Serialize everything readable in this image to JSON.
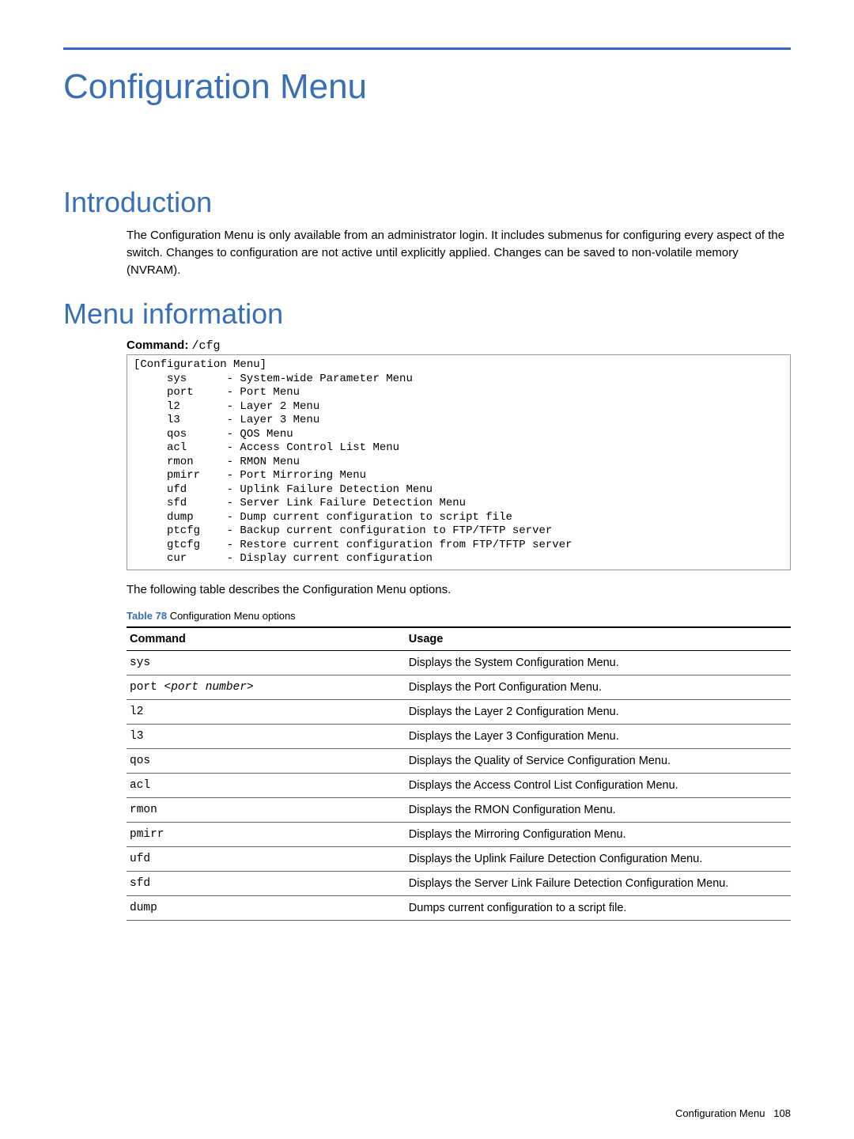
{
  "chapter_title": "Configuration Menu",
  "intro": {
    "heading": "Introduction",
    "body": "The Configuration Menu is only available from an administrator login. It includes submenus for configuring every aspect of the switch. Changes to configuration are not active until explicitly applied. Changes can be saved to non-volatile memory (NVRAM)."
  },
  "menu_info": {
    "heading": "Menu information",
    "command_label": "Command:",
    "command_value": "/cfg",
    "code": "[Configuration Menu]\n     sys      - System-wide Parameter Menu\n     port     - Port Menu\n     l2       - Layer 2 Menu\n     l3       - Layer 3 Menu\n     qos      - QOS Menu\n     acl      - Access Control List Menu\n     rmon     - RMON Menu\n     pmirr    - Port Mirroring Menu\n     ufd      - Uplink Failure Detection Menu\n     sfd      - Server Link Failure Detection Menu\n     dump     - Dump current configuration to script file\n     ptcfg    - Backup current configuration to FTP/TFTP server\n     gtcfg    - Restore current configuration from FTP/TFTP server\n     cur      - Display current configuration",
    "after_code_text": "The following table describes the Configuration Menu options.",
    "table_label": "Table 78",
    "table_caption": "Configuration Menu options",
    "table_head_command": "Command",
    "table_head_usage": "Usage",
    "rows": [
      {
        "cmd": "sys",
        "usage": "Displays the System Configuration Menu."
      },
      {
        "cmd": "port <port number>",
        "usage": "Displays the Port Configuration Menu."
      },
      {
        "cmd": "l2",
        "usage": "Displays the Layer 2 Configuration Menu."
      },
      {
        "cmd": "l3",
        "usage": "Displays the Layer 3 Configuration Menu."
      },
      {
        "cmd": "qos",
        "usage": "Displays the Quality of Service Configuration Menu."
      },
      {
        "cmd": "acl",
        "usage": "Displays the Access Control List Configuration Menu."
      },
      {
        "cmd": "rmon",
        "usage": "Displays the RMON Configuration Menu."
      },
      {
        "cmd": "pmirr",
        "usage": "Displays the Mirroring Configuration Menu."
      },
      {
        "cmd": "ufd",
        "usage": "Displays the Uplink Failure Detection Configuration Menu."
      },
      {
        "cmd": "sfd",
        "usage": "Displays the Server Link Failure Detection Configuration Menu."
      },
      {
        "cmd": "dump",
        "usage": "Dumps current configuration to a script file."
      }
    ]
  },
  "footer": {
    "title": "Configuration Menu",
    "page": "108"
  }
}
